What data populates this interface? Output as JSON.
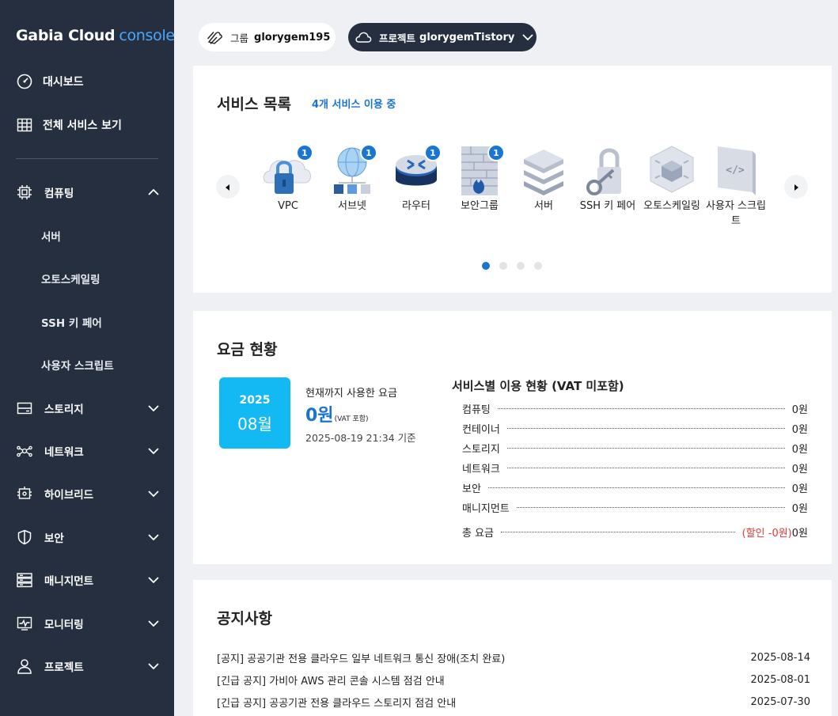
{
  "brand": {
    "name": "Gabia Cloud",
    "accent": "console"
  },
  "sidebar": {
    "top": [
      {
        "label": "대시보드",
        "icon": "dashboard-icon"
      },
      {
        "label": "전체 서비스 보기",
        "icon": "grid-icon"
      }
    ],
    "sections": [
      {
        "label": "컴퓨팅",
        "icon": "chip-icon",
        "expanded": true,
        "children": [
          "서버",
          "오토스케일링",
          "SSH 키 페어",
          "사용자 스크립트"
        ]
      },
      {
        "label": "스토리지",
        "icon": "storage-icon",
        "expanded": false
      },
      {
        "label": "네트워크",
        "icon": "network-icon",
        "expanded": false
      },
      {
        "label": "하이브리드",
        "icon": "hybrid-icon",
        "expanded": false
      },
      {
        "label": "보안",
        "icon": "shield-icon",
        "expanded": false
      },
      {
        "label": "매니지먼트",
        "icon": "management-icon",
        "expanded": false
      },
      {
        "label": "모니터링",
        "icon": "monitor-icon",
        "expanded": false
      },
      {
        "label": "프로젝트",
        "icon": "user-icon",
        "expanded": false
      }
    ]
  },
  "header": {
    "group_label": "그룹",
    "group_value": "glorygem195",
    "project_label": "프로젝트",
    "project_value": "glorygemTistory"
  },
  "services": {
    "title": "서비스 목록",
    "count_text": "4개 서비스 이용 중",
    "items": [
      {
        "name": "VPC",
        "badge": "1"
      },
      {
        "name": "서브넷",
        "badge": "1"
      },
      {
        "name": "라우터",
        "badge": "1"
      },
      {
        "name": "보안그룹",
        "badge": "1"
      },
      {
        "name": "서버",
        "badge": ""
      },
      {
        "name": "SSH 키 페어",
        "badge": ""
      },
      {
        "name": "오토스케일링",
        "badge": ""
      },
      {
        "name": "사용자 스크립트",
        "badge": ""
      }
    ],
    "pages": 4,
    "active_page": 1
  },
  "billing": {
    "title": "요금 현황",
    "year": "2025",
    "month": "08월",
    "used_label": "현재까지 사용한 요금",
    "used_value": "0원",
    "used_note": "(VAT 포함)",
    "used_time": "2025-08-19 21:34 기준",
    "usage_title": "서비스별 이용 현황 (VAT 미포함)",
    "rows": [
      {
        "label": "컴퓨팅",
        "value": "0원"
      },
      {
        "label": "컨테이너",
        "value": "0원"
      },
      {
        "label": "스토리지",
        "value": "0원"
      },
      {
        "label": "네트워크",
        "value": "0원"
      },
      {
        "label": "보안",
        "value": "0원"
      },
      {
        "label": "매니지먼트",
        "value": "0원"
      }
    ],
    "total_label": "총 요금",
    "total_discount": "(할인 -0원)",
    "total_value": "0원"
  },
  "notices": {
    "title": "공지사항",
    "items": [
      {
        "title": "[공지] 공공기관 전용 클라우드 일부 네트워크 통신 장애(조치 완료)",
        "date": "2025-08-14"
      },
      {
        "title": "[긴급 공지] 가비아 AWS 관리 콘솔 시스템 점검 안내",
        "date": "2025-08-01"
      },
      {
        "title": "[긴급 공지] 공공기관 전용 클라우드 스토리지 점검 안내",
        "date": "2025-07-30"
      }
    ]
  },
  "colors": {
    "sidebar": "#252f3f",
    "accent": "#1a73d1",
    "calendar": "#13b9f2",
    "discount": "#e53935"
  }
}
